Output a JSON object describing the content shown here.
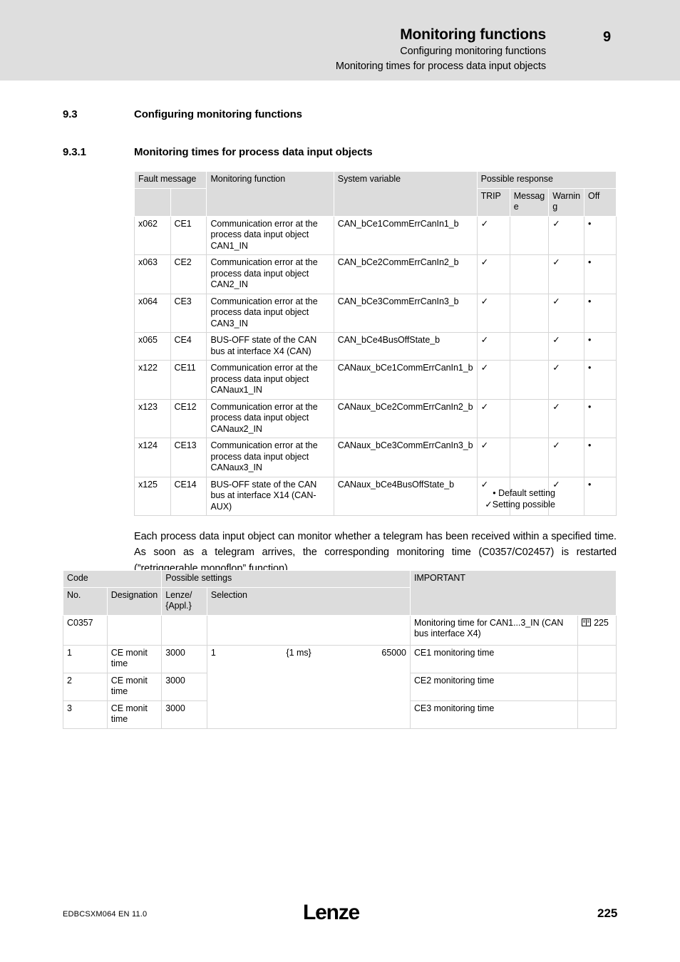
{
  "header": {
    "title": "Monitoring functions",
    "sub1": "Configuring monitoring functions",
    "sub2": "Monitoring times for process data input objects",
    "chapter_number": "9"
  },
  "sections": [
    {
      "number": "9.3",
      "title": "Configuring monitoring functions"
    },
    {
      "number": "9.3.1",
      "title": "Monitoring times for process data input objects"
    }
  ],
  "fault_table": {
    "headers": {
      "fault_message": "Fault message",
      "monitoring_function": "Monitoring function",
      "system_variable": "System variable",
      "possible_response": "Possible response",
      "response_cols": [
        "TRIP",
        "Messag e",
        "Warnin g",
        "Off"
      ]
    },
    "rows": [
      {
        "code": "x062",
        "ce": "CE1",
        "function": "Communication error at the process data input object CAN1_IN",
        "variable": "CAN_bCe1CommErrCanIn1_b",
        "trip": "✓",
        "message": "",
        "warning": "✓",
        "off": "•"
      },
      {
        "code": "x063",
        "ce": "CE2",
        "function": "Communication error at the process data input object CAN2_IN",
        "variable": "CAN_bCe2CommErrCanIn2_b",
        "trip": "✓",
        "message": "",
        "warning": "✓",
        "off": "•"
      },
      {
        "code": "x064",
        "ce": "CE3",
        "function": "Communication error at the process data input object CAN3_IN",
        "variable": "CAN_bCe3CommErrCanIn3_b",
        "trip": "✓",
        "message": "",
        "warning": "✓",
        "off": "•"
      },
      {
        "code": "x065",
        "ce": "CE4",
        "function": "BUS-OFF state of the CAN bus at interface X4 (CAN)",
        "variable": "CAN_bCe4BusOffState_b",
        "trip": "✓",
        "message": "",
        "warning": "✓",
        "off": "•"
      },
      {
        "code": "x122",
        "ce": "CE11",
        "function": "Communication error at the process data input object CANaux1_IN",
        "variable": "CANaux_bCe1CommErrCanIn1_b",
        "trip": "✓",
        "message": "",
        "warning": "✓",
        "off": "•"
      },
      {
        "code": "x123",
        "ce": "CE12",
        "function": "Communication error at the process data input object CANaux2_IN",
        "variable": "CANaux_bCe2CommErrCanIn2_b",
        "trip": "✓",
        "message": "",
        "warning": "✓",
        "off": "•"
      },
      {
        "code": "x124",
        "ce": "CE13",
        "function": "Communication error at the process data input object CANaux3_IN",
        "variable": "CANaux_bCe3CommErrCanIn3_b",
        "trip": "✓",
        "message": "",
        "warning": "✓",
        "off": "•"
      },
      {
        "code": "x125",
        "ce": "CE14",
        "function": "BUS-OFF state of the CAN bus at interface X14 (CAN-AUX)",
        "variable": "CANaux_bCe4BusOffState_b",
        "trip": "✓",
        "message": "",
        "warning": "✓",
        "off": "•"
      }
    ],
    "legend": {
      "default_setting": "• Default setting",
      "setting_possible": "✓Setting possible"
    }
  },
  "paragraph": "Each process data input object can monitor whether a telegram has been received within a specified time. As soon as a telegram arrives, the corresponding monitoring time (C0357/C02457) is restarted (”retriggerable monoflop” function).",
  "code_table": {
    "headers": {
      "code": "Code",
      "possible_settings": "Possible settings",
      "important": "IMPORTANT",
      "no": "No.",
      "designation": "Designation",
      "lenze_appl": "Lenze/\n{Appl.}",
      "lenze_appl_line1": "Lenze/",
      "lenze_appl_line2": "{Appl.}",
      "selection": "Selection"
    },
    "rows": [
      {
        "no": "C0357",
        "designation": "",
        "lenze": "",
        "sel_min": "",
        "sel_unit": "",
        "sel_max": "",
        "important": "Monitoring time for CAN1...3_IN (CAN bus interface X4)",
        "ref_icon": "book-icon",
        "ref_page": "225"
      },
      {
        "no": "1",
        "designation": "CE monit time",
        "lenze": "3000",
        "sel_min": "1",
        "sel_unit": "{1 ms}",
        "sel_max": "65000",
        "important": "CE1 monitoring time",
        "ref_page": ""
      },
      {
        "no": "2",
        "designation": "CE monit time",
        "lenze": "3000",
        "sel_min": "",
        "sel_unit": "",
        "sel_max": "",
        "important": "CE2 monitoring time",
        "ref_page": ""
      },
      {
        "no": "3",
        "designation": "CE monit time",
        "lenze": "3000",
        "sel_min": "",
        "sel_unit": "",
        "sel_max": "",
        "important": "CE3 monitoring time",
        "ref_page": ""
      }
    ]
  },
  "footer": {
    "doc_code": "EDBCSXM064  EN  11.0",
    "logo": "Lenze",
    "page": "225"
  },
  "colors": {
    "header_band": "#dedede",
    "table_header": "#dcdcdc",
    "rule": "#8c8c8c",
    "cell_border": "#d6d6d6"
  }
}
